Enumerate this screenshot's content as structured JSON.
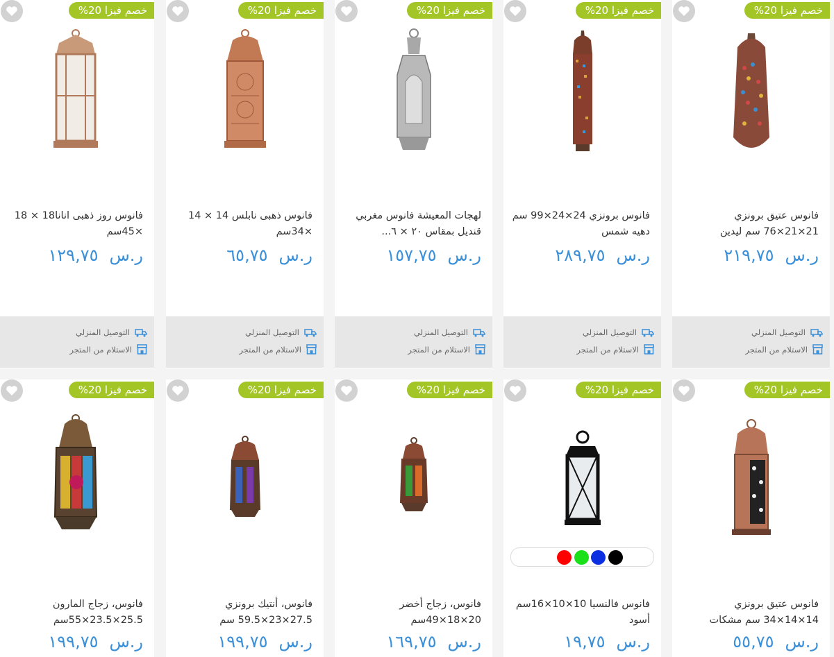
{
  "badge_text": "خصم فيزا 20%",
  "currency": "ر.س",
  "delivery_label": "التوصيل المنزلي",
  "pickup_label": "الاستلام من المتجر",
  "colors": {
    "badge": "#a3c525",
    "price": "#3a8fd9",
    "favorite": "#d2d2d2"
  },
  "products": [
    {
      "title": "فانوس عتيق برونزي 21×21×76 سم ليدين",
      "price": "٢١٩,٧٥",
      "icon": "lantern-icon"
    },
    {
      "title": "فانوس برونزي 24×24×99 سم دهيه شمس",
      "price": "٢٨٩,٧٥",
      "icon": "lantern-icon"
    },
    {
      "title": "لهجات المعيشة فانوس مغربي قنديل بمقاس ٢٠ × ٦...",
      "price": "١٥٧,٧٥",
      "icon": "lantern-icon"
    },
    {
      "title": "فانوس ذهبى نابلس 14 × 14 ×34سم",
      "price": "٦٥,٧٥",
      "icon": "lantern-icon"
    },
    {
      "title": "فانوس روز ذهبى انانا18 × 18 ×45سم",
      "price": "١٢٩,٧٥",
      "icon": "lantern-icon"
    },
    {
      "title": "فانوس عتيق برونزي 14×14×34 سم مشكات",
      "price": "٥٥,٧٥",
      "icon": "lantern-icon"
    },
    {
      "title": "فانوس فالنسيا 10×10×16سم أسود",
      "price": "١٩,٧٥",
      "icon": "lantern-icon",
      "color_options": [
        "#000000",
        "#0a2ee0",
        "#19e019",
        "#ff0000",
        "#ffffff"
      ]
    },
    {
      "title": "فانوس، زجاج أخضر 20×18×49سم",
      "price": "١٦٩,٧٥",
      "icon": "lantern-icon"
    },
    {
      "title": "فانوس، أنتيك برونزي 27.5×23×59.5 سم",
      "price": "١٩٩,٧٥",
      "icon": "lantern-icon"
    },
    {
      "title": "فانوس، زجاج المارون 25.5×23.5×55سم",
      "price": "١٩٩,٧٥",
      "icon": "lantern-icon"
    }
  ]
}
